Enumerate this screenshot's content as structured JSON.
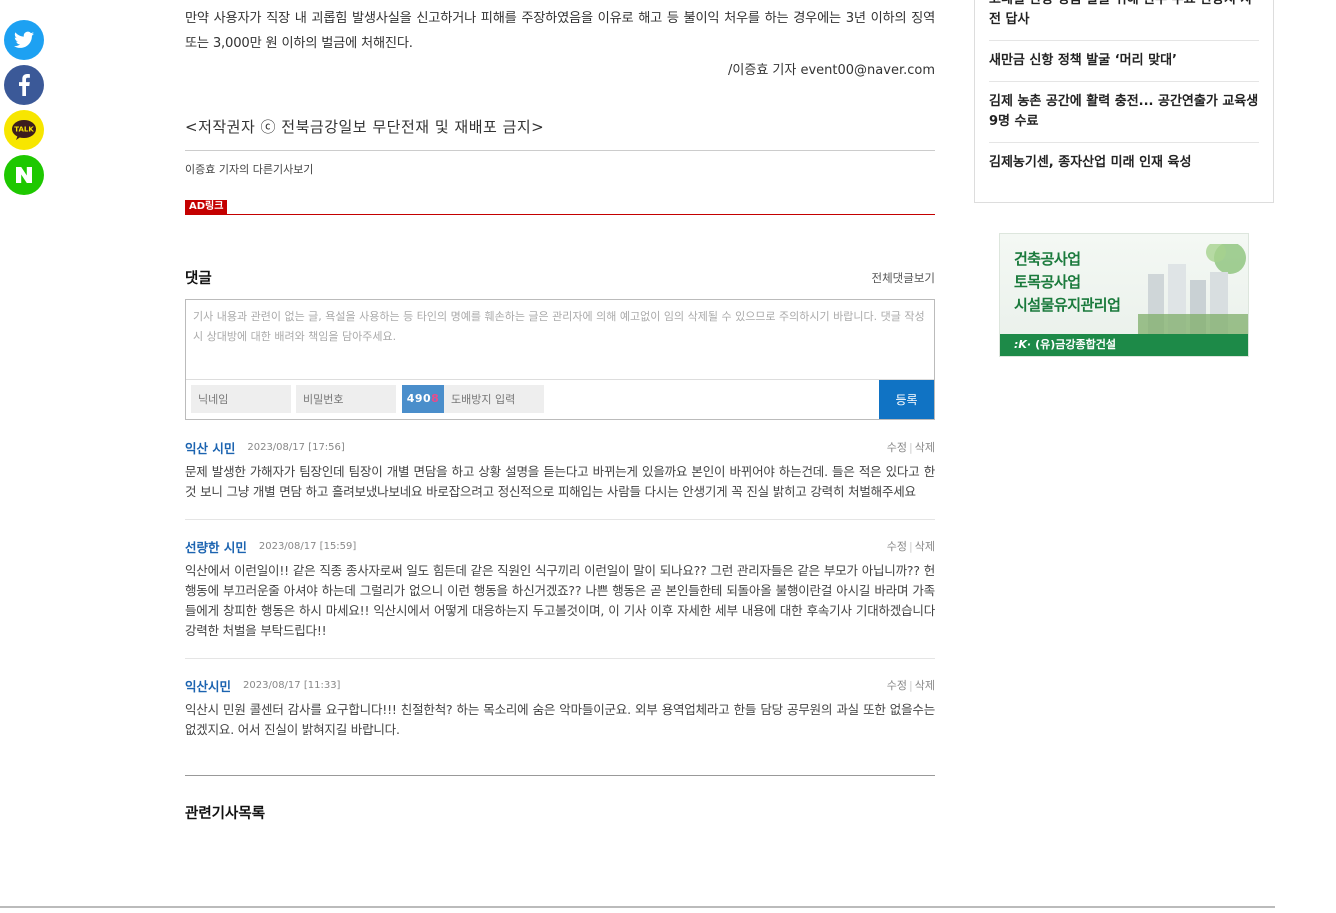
{
  "social": {
    "twitter": "twitter",
    "facebook": "facebook",
    "kakao": "TALK",
    "naver": "N"
  },
  "article": {
    "paragraph": "만약 사용자가 직장 내 괴롭힘 발생사실을 신고하거나 피해를 주장하였음을 이유로 해고 등 불이익 처우를 하는 경우에는 3년 이하의 징역 또는 3,000만 원 이하의 벌금에 처해진다.",
    "byline": "/이증효 기자 event00@naver.com",
    "copyright": "<저작권자 ⓒ 전북금강일보 무단전재 및 재배포 금지>",
    "more_link": "이증효 기자의 다른기사보기"
  },
  "ad_link_label": "AD링크",
  "comments_section": {
    "title": "댓글",
    "view_all": "전체댓글보기",
    "textarea_placeholder": "기사 내용과 관련이 없는 글, 욕설을 사용하는 등 타인의 명예를 훼손하는 글은 관리자에 의해 예고없이 임의 삭제될 수 있으므로 주의하시기 바랍니다. 댓글 작성 시 상대방에 대한 배려와 책임을 담아주세요.",
    "nickname_placeholder": "닉네임",
    "password_placeholder": "비밀번호",
    "captcha_main": "490",
    "captcha_red": "8",
    "spam_placeholder": "도배방지 입력",
    "submit_label": "등록",
    "edit_label": "수정",
    "delete_label": "삭제",
    "items": [
      {
        "name": "익산 시민",
        "date": "2023/08/17 [17:56]",
        "text": "문제 발생한 가해자가 팀장인데 팀장이 개별 면담을 하고 상황 설명을 듣는다고 바뀌는게 있을까요 본인이 바뀌어야 하는건데. 들은 적은 있다고 한 것 보니 그냥 개별 면담 하고 흘려보냈나보네요 바로잡으려고 정신적으로 피해입는 사람들 다시는 안생기게 꼭 진실 밝히고 강력히 처벌해주세요"
      },
      {
        "name": "선량한 시민",
        "date": "2023/08/17 [15:59]",
        "text": "익산에서 이런일이!! 같은 직종 종사자로써 일도 힘든데 같은 직원인 식구끼리 이런일이 말이 되나요?? 그런 관리자들은 같은 부모가 아닙니까?? 헌행동에 부끄러운줄 아셔야 하는데 그럴리가 없으니 이런 행동을 하신거겠죠?? 나쁜 행동은 곧 본인들한테 되돌아올 불행이란걸 아시길 바라며 가족들에게 창피한 행동은 하시 마세요!! 익산시에서 어떻게 대응하는지 두고볼것이며, 이 기사 이후 자세한 세부 내용에 대한 후속기사 기대하겠습니다 강력한 처벌을 부탁드립다!!"
      },
      {
        "name": "익산시민",
        "date": "2023/08/17 [11:33]",
        "text": "익산시 민원 콜센터 감사를 요구합니다!!! 친절한척? 하는 목소리에 숨은 악마들이군요. 외부 용역업체라고 한들 담당 공무원의 과실 또한 없을수는 없겠지요. 어서 진실이 밝혀지길 바랍니다."
      }
    ]
  },
  "related": {
    "title": "관련기사목록"
  },
  "sidebar": {
    "items": [
      "코레일 관광 상품 발굴 위해 완주 주요 관광지 사전 답사",
      "새만금 신항 정책 발굴 ‘머리 맞대’",
      "김제 농촌 공간에 활력 충전... 공간연출가 교육생 9명 수료",
      "김제농기센, 종자산업 미래 인재 육성"
    ]
  },
  "ad_banner": {
    "line1": "건축공사업",
    "line2": "토목공사업",
    "line3": "시설물유지관리업",
    "company": "(유)금강종합건설",
    "accent_color": "#1d8a48"
  }
}
